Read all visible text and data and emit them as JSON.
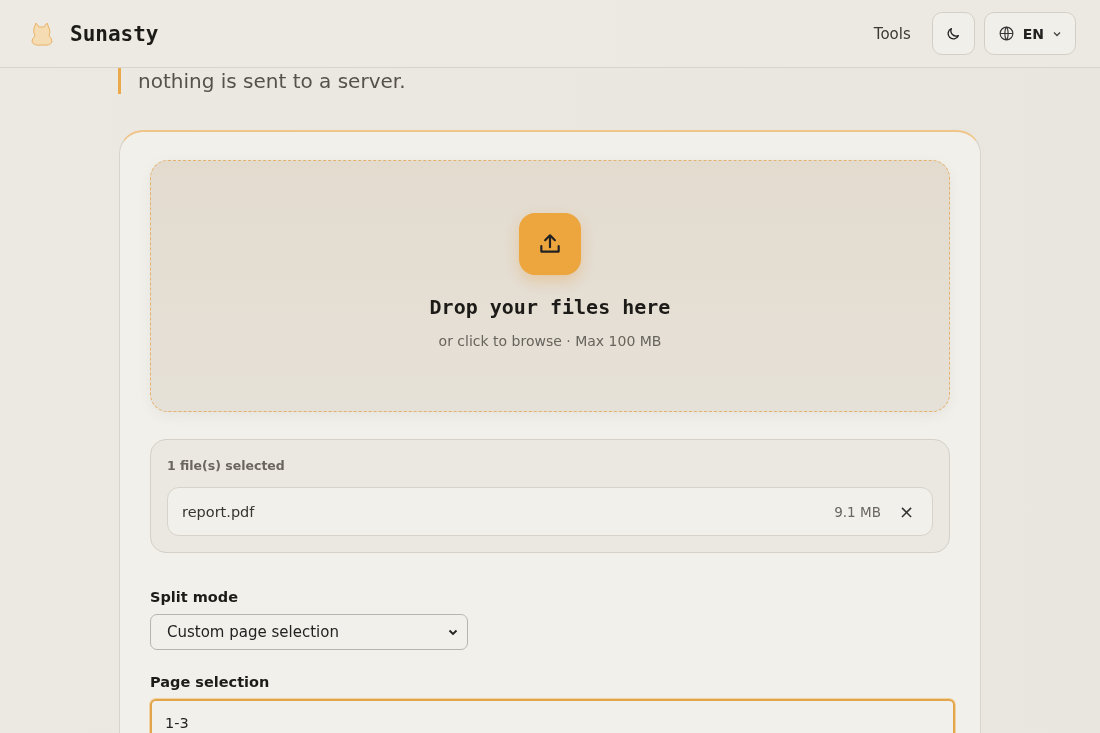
{
  "header": {
    "brand": "Sunasty",
    "nav": [
      {
        "label": "Tools"
      }
    ],
    "language": "EN"
  },
  "intro": {
    "text": "nothing is sent to a server."
  },
  "dropzone": {
    "title": "Drop your files here",
    "hint": "or click to browse · Max 100 MB"
  },
  "files": {
    "count_label": "1 file(s) selected",
    "items": [
      {
        "name": "report.pdf",
        "size": "9.1 MB",
        "remove": "×"
      }
    ]
  },
  "split_mode": {
    "label": "Split mode",
    "value": "Custom page selection"
  },
  "page_selection": {
    "label": "Page selection",
    "value": "1-3",
    "focused": true
  }
}
